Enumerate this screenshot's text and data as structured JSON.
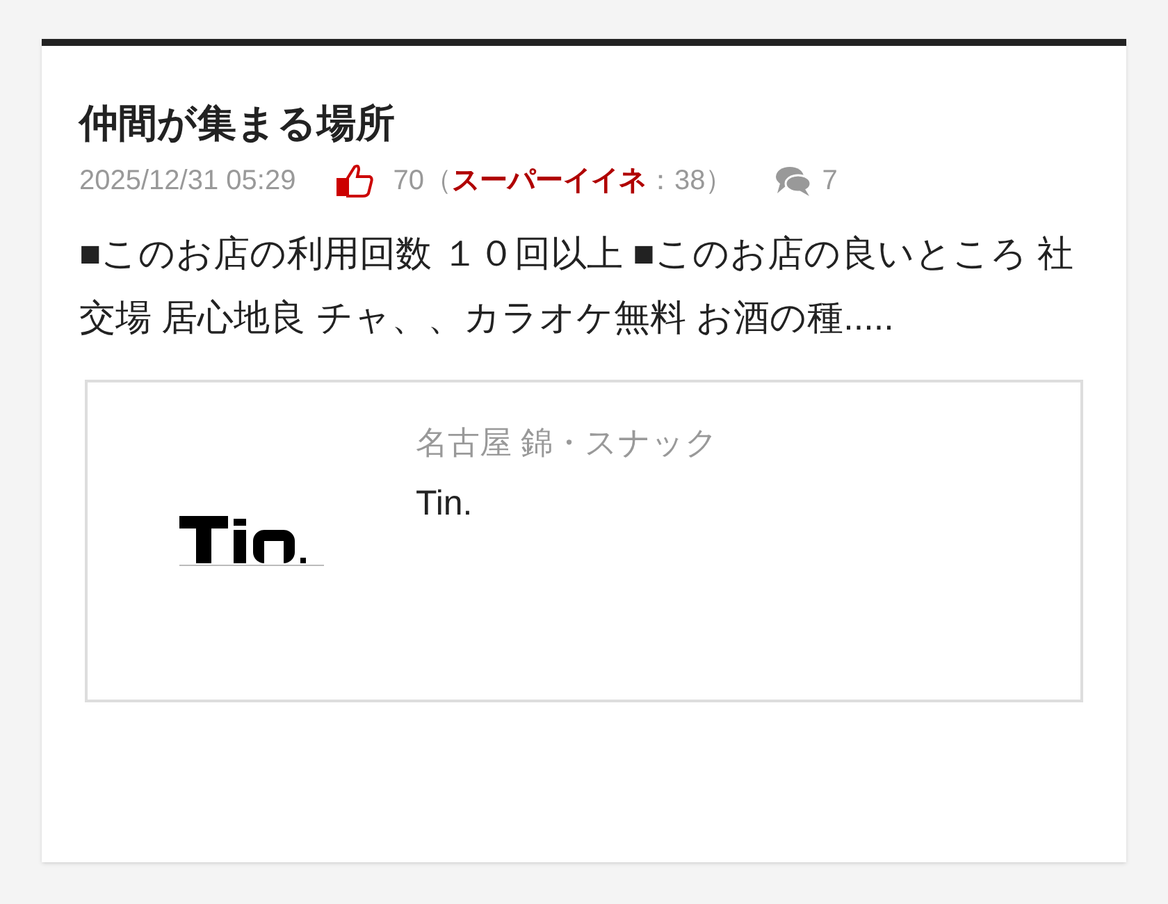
{
  "post": {
    "title": "仲間が集まる場所",
    "date": "2025/12/31 05:29",
    "likes": {
      "count": "70",
      "super_open": "（",
      "super_label": "スーパーイイネ",
      "super_count": "：38）"
    },
    "comments": "7",
    "body": "■このお店の利用回数 １０回以上 ■このお店の良いところ 社交場 居心地良 チャ、、カラオケ無料 お酒の種.....",
    "shop": {
      "area": "名古屋 錦・スナック",
      "name": "Tin."
    }
  }
}
